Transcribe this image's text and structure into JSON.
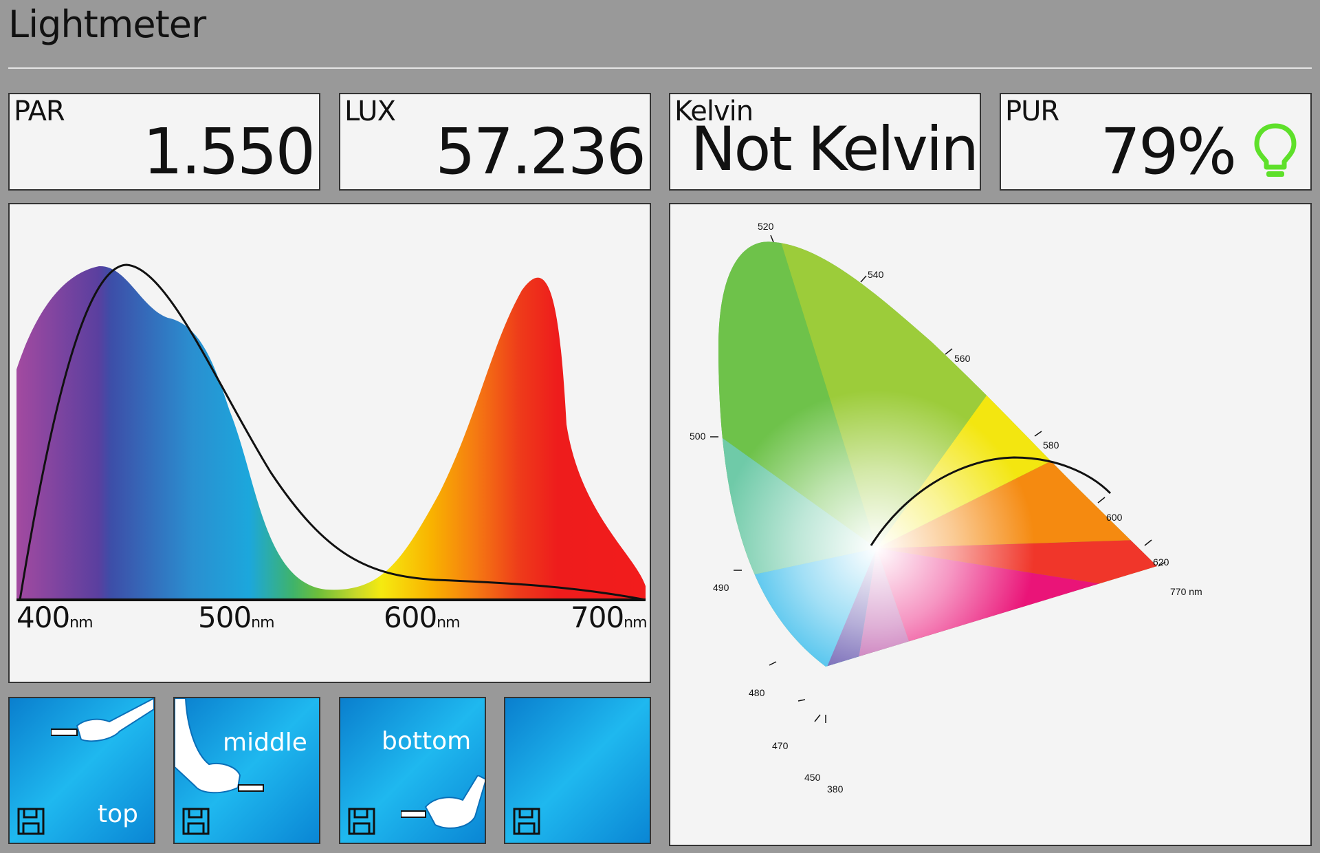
{
  "app": {
    "title": "Lightmeter"
  },
  "metrics": {
    "par": {
      "label": "PAR",
      "value": "1.550"
    },
    "lux": {
      "label": "LUX",
      "value": "57.236"
    },
    "kelvin": {
      "label": "Kelvin",
      "value": "Not Kelvin"
    },
    "pur": {
      "label": "PUR",
      "value": "79%",
      "icon": "lightbulb-icon",
      "icon_color": "#5ee02a"
    }
  },
  "spectrum": {
    "x_ticks": [
      {
        "value": "400",
        "unit": "nm"
      },
      {
        "value": "500",
        "unit": "nm"
      },
      {
        "value": "600",
        "unit": "nm"
      },
      {
        "value": "700",
        "unit": "nm"
      }
    ]
  },
  "cie": {
    "wavelength_labels": [
      "520",
      "540",
      "560",
      "580",
      "600",
      "620",
      "770 nm",
      "500",
      "490",
      "480",
      "470",
      "450",
      "380"
    ]
  },
  "presets": [
    {
      "label": "top"
    },
    {
      "label": "middle"
    },
    {
      "label": "bottom"
    },
    {
      "label": ""
    }
  ],
  "colors": {
    "background": "#999999",
    "card": "#f4f4f4",
    "preset_blue": "#1fb8ef",
    "pur_bulb": "#5ee02a"
  }
}
